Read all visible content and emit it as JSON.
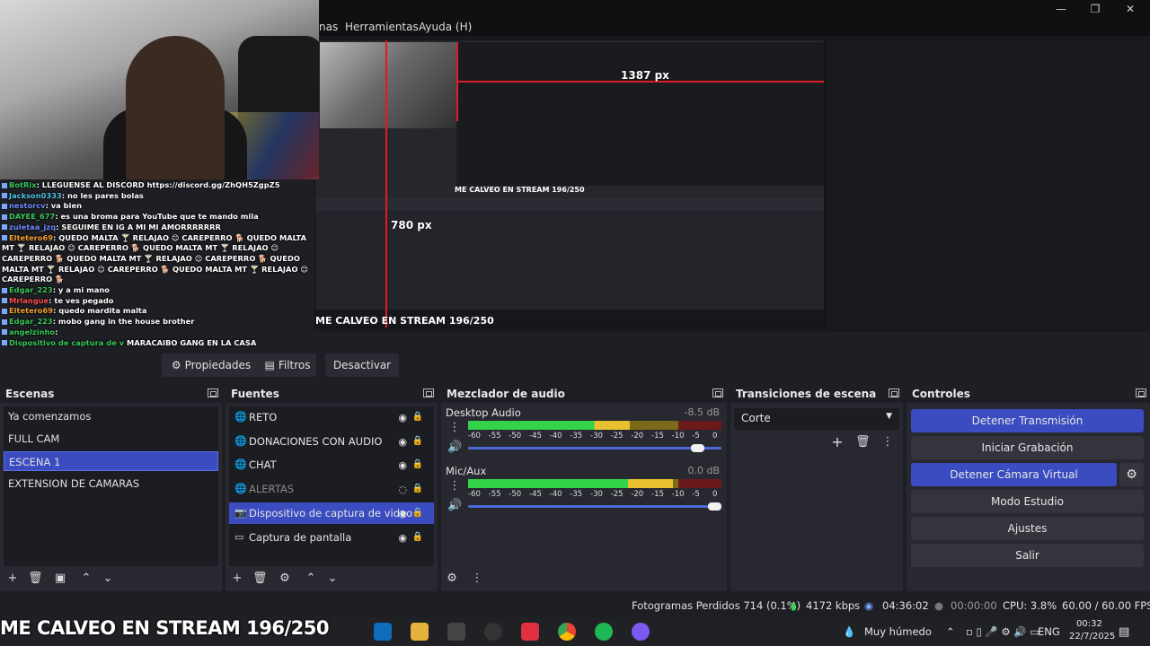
{
  "menu": {
    "partial": "nas",
    "tools": "Herramientas",
    "help": "Ayuda (H)"
  },
  "window": {
    "minimize": "—",
    "maximize": "❐",
    "close": "✕"
  },
  "preview": {
    "px_vertical": "780 px",
    "px_horizontal": "1387 px",
    "banner": "ME CALVEO EN STREAM 196/250",
    "inner_banner": "ME CALVEO EN STREAM 196/250"
  },
  "chat": [
    {
      "user": "BotRix",
      "msg": ": LLEGUENSE AL DISCORD https://discord.gg/ZhQH5ZgpZ5",
      "color": "u-green"
    },
    {
      "user": "Jackson0333",
      "msg": ": no les pares bolas",
      "color": "u-cyan"
    },
    {
      "user": "nestorcv",
      "msg": ": va bien",
      "color": "u-blue"
    },
    {
      "user": "DAYEE_677",
      "msg": ": es una broma para YouTube que te mando mila",
      "color": ""
    },
    {
      "user": "zuletaa_jzq",
      "msg": ": SEGUIME EN IG A MI MI AMORRRRRRR",
      "color": "u-blue"
    },
    {
      "user": "Eltetero69",
      "msg": ": QUEDO MALTA 🍸 RELAJAO 😊 CAREPERRO 🐕 QUEDO MALTA",
      "color": "u-orange"
    },
    {
      "user": "",
      "msg": "MT 🍸 RELAJAO 😊 CAREPERRO 🐕 QUEDO MALTA MT 🍸 RELAJAO 😊",
      "color": ""
    },
    {
      "user": "",
      "msg": "CAREPERRO 🐕 QUEDO MALTA MT 🍸 RELAJAO 😊 CAREPERRO 🐕 QUEDO",
      "color": ""
    },
    {
      "user": "",
      "msg": "MALTA MT 🍸 RELAJAO 😊 CAREPERRO 🐕 QUEDO MALTA MT 🍸 RELAJAO 😊",
      "color": ""
    },
    {
      "user": "",
      "msg": "CAREPERRO 🐕",
      "color": ""
    },
    {
      "user": "Edgar_223",
      "msg": ": y a mi mano",
      "color": "u-green"
    },
    {
      "user": "Mrlangue",
      "msg": ": te ves pegado",
      "color": "u-red"
    },
    {
      "user": "Eltetero69",
      "msg": ": quedo mardita malta",
      "color": "u-orange"
    },
    {
      "user": "Edgar_223",
      "msg": ": mobo gang in the house brother",
      "color": "u-green"
    },
    {
      "user": "angelzinho",
      "msg": ":",
      "color": "u-green"
    },
    {
      "user": "Dispositivo de captura de v",
      "msg": " MARACAIBO GANG EN LA CASA",
      "color": ""
    }
  ],
  "toolbar": {
    "properties": "Propiedades",
    "filters": "Filtros",
    "deactivate": "Desactivar",
    "source_label": "Dispositivo de captura de v"
  },
  "scenes": {
    "title": "Escenas",
    "items": [
      "Ya comenzamos",
      "FULL CAM",
      "ESCENA 1",
      "EXTENSION DE CAMARAS"
    ],
    "selected": 2
  },
  "sources": {
    "title": "Fuentes",
    "items": [
      {
        "label": "RETO",
        "icon": "globe-icon",
        "dim": false
      },
      {
        "label": "DONACIONES CON AUDIO",
        "icon": "globe-icon",
        "dim": false
      },
      {
        "label": "CHAT",
        "icon": "globe-icon",
        "dim": false
      },
      {
        "label": "ALERTAS",
        "icon": "globe-icon",
        "dim": true
      },
      {
        "label": "Dispositivo de captura de video",
        "icon": "camera-icon",
        "dim": false
      },
      {
        "label": "Captura de pantalla",
        "icon": "monitor-icon",
        "dim": false
      }
    ],
    "selected": 4
  },
  "mixer": {
    "title": "Mezclador de audio",
    "channels": [
      {
        "name": "Desktop Audio",
        "db": "-8.5 dB",
        "level": 0.64,
        "volume": 0.93
      },
      {
        "name": "Mic/Aux",
        "db": "0.0 dB",
        "level": 0.81,
        "volume": 1.0
      }
    ],
    "scale": [
      "-60",
      "-55",
      "-50",
      "-45",
      "-40",
      "-35",
      "-30",
      "-25",
      "-20",
      "-15",
      "-10",
      "-5",
      "0"
    ]
  },
  "transitions": {
    "title": "Transiciones de escena",
    "selected": "Corte"
  },
  "controls": {
    "title": "Controles",
    "stop_stream": "Detener Transmisión",
    "start_recording": "Iniciar Grabación",
    "stop_virtual_cam": "Detener Cámara Virtual",
    "studio_mode": "Modo Estudio",
    "settings": "Ajustes",
    "exit": "Salir"
  },
  "status": {
    "dropped": "Fotogramas Perdidos 714 (0.1%)",
    "bitrate": "4172 kbps",
    "stream_time": "04:36:02",
    "rec_time": "00:00:00",
    "cpu": "CPU: 3.8%",
    "fps": "60.00 / 60.00 FPS"
  },
  "taskbar": {
    "banner": "ME CALVEO EN STREAM 196/250",
    "weather": "Muy húmedo",
    "lang": "ENG",
    "time": "00:32",
    "date": "22/7/2025"
  },
  "colors": {
    "accent": "#3a4cc0",
    "panel": "#272830",
    "bg": "#1e1f24"
  }
}
